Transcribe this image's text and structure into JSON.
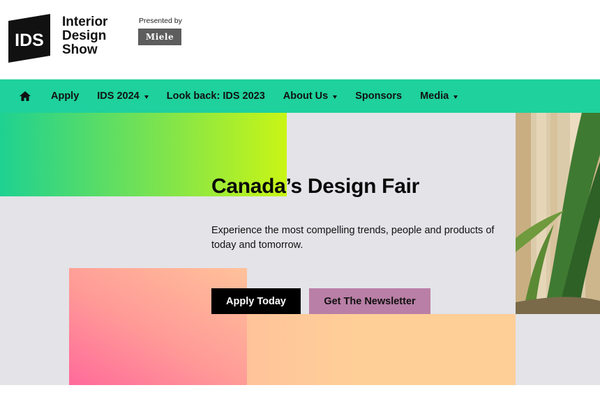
{
  "header": {
    "logo_mark": "IDS",
    "brand_lines": [
      "Interior",
      "Design",
      "Show"
    ],
    "presented_by": "Presented by",
    "sponsor_logo": "Miele"
  },
  "nav": {
    "home_icon": "home-icon",
    "items": [
      {
        "label": "Apply",
        "has_dropdown": false
      },
      {
        "label": "IDS 2024",
        "has_dropdown": true
      },
      {
        "label": "Look back: IDS 2023",
        "has_dropdown": false
      },
      {
        "label": "About Us",
        "has_dropdown": true
      },
      {
        "label": "Sponsors",
        "has_dropdown": false
      },
      {
        "label": "Media",
        "has_dropdown": true
      }
    ]
  },
  "hero": {
    "title": "Canada’s Design Fair",
    "subtitle": "Experience the most compelling trends, people and products of today and tomorrow.",
    "primary_button": "Apply Today",
    "secondary_button": "Get The Newsletter"
  },
  "colors": {
    "nav_bg": "#1fd19c",
    "hero_bg": "#e3e3e8",
    "primary_button_bg": "#000000",
    "secondary_button_bg": "#b97fa6"
  }
}
